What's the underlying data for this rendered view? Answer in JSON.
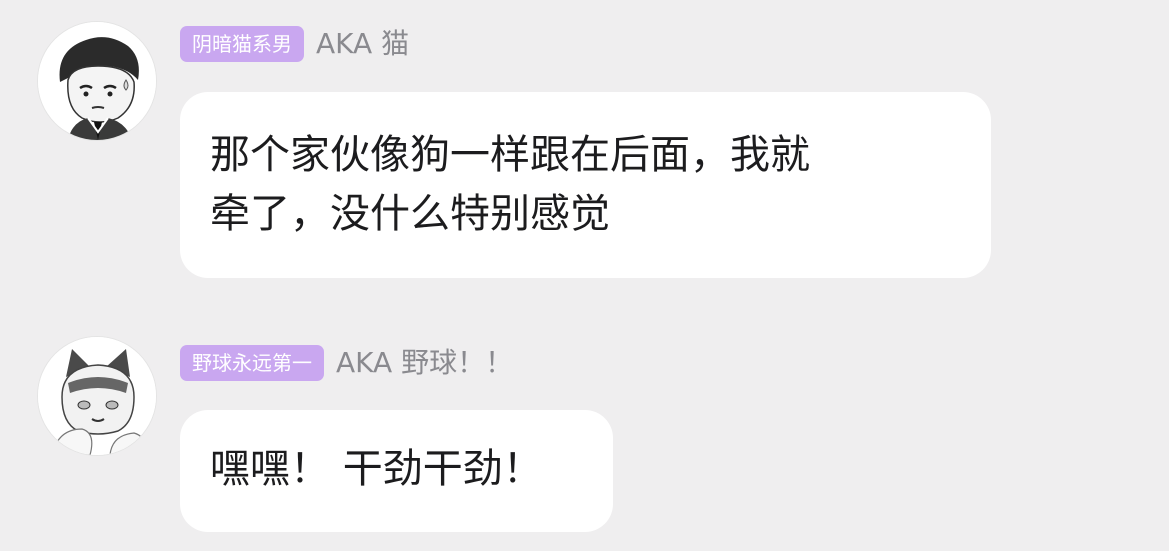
{
  "messages": [
    {
      "avatar_icon": "cartoon-boy-suit-avatar-icon",
      "badge": "阴暗猫系男",
      "alias": "AKA 猫",
      "line1": "那个家伙像狗一样跟在后面，我就",
      "line2": "牵了，没什么特别感觉"
    },
    {
      "avatar_icon": "cartoon-boy-cat-ears-avatar-icon",
      "badge": "野球永远第一",
      "alias": "AKA 野球！！",
      "line1": "嘿嘿！ 干劲干劲！"
    }
  ],
  "colors": {
    "background": "#efeeef",
    "badge": "#c9a7f0",
    "bubble": "#ffffff",
    "alias_text": "#8a8a8f"
  }
}
